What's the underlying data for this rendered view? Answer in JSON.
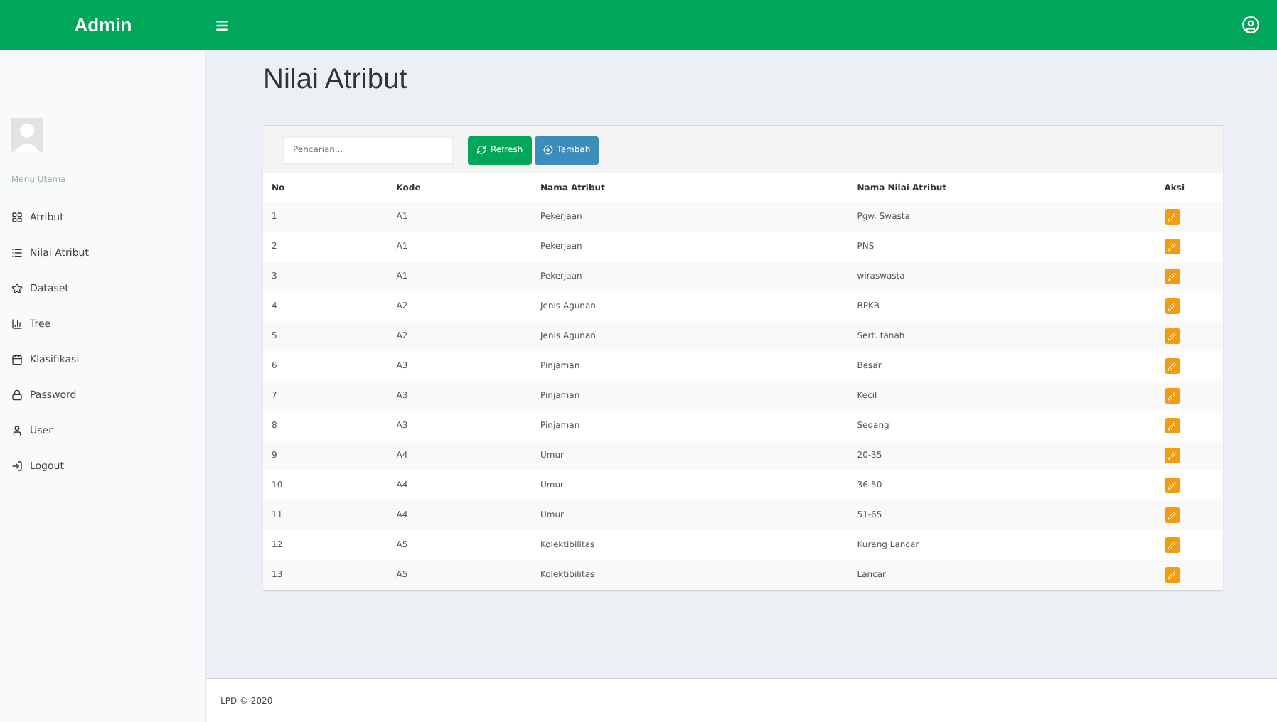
{
  "brand": "Admin",
  "sidebar": {
    "header": "Menu Utama",
    "items": [
      {
        "label": "Atribut"
      },
      {
        "label": "Nilai Atribut"
      },
      {
        "label": "Dataset"
      },
      {
        "label": "Tree"
      },
      {
        "label": "Klasifikasi"
      },
      {
        "label": "Password"
      },
      {
        "label": "User"
      },
      {
        "label": "Logout"
      }
    ]
  },
  "page_title": "Nilai Atribut",
  "search": {
    "placeholder": "Pencarian..."
  },
  "buttons": [
    {
      "label": "Refresh",
      "kind": "refresh"
    },
    {
      "label": "Tambah",
      "kind": "add"
    }
  ],
  "table": {
    "columns": [
      "No",
      "Kode",
      "Nama Atribut",
      "Nama Nilai Atribut",
      "Aksi"
    ],
    "rows": [
      [
        "1",
        "A1",
        "Pekerjaan",
        "Pgw. Swasta"
      ],
      [
        "2",
        "A1",
        "Pekerjaan",
        "PNS"
      ],
      [
        "3",
        "A1",
        "Pekerjaan",
        "wiraswasta"
      ],
      [
        "4",
        "A2",
        "Jenis Agunan",
        "BPKB"
      ],
      [
        "5",
        "A2",
        "Jenis Agunan",
        "Sert. tanah"
      ],
      [
        "6",
        "A3",
        "Pinjaman",
        "Besar"
      ],
      [
        "7",
        "A3",
        "Pinjaman",
        "Kecil"
      ],
      [
        "8",
        "A3",
        "Pinjaman",
        "Sedang"
      ],
      [
        "9",
        "A4",
        "Umur",
        "20-35"
      ],
      [
        "10",
        "A4",
        "Umur",
        "36-50"
      ],
      [
        "11",
        "A4",
        "Umur",
        "51-65"
      ],
      [
        "12",
        "A5",
        "Kolektibilitas",
        "Kurang Lancar"
      ],
      [
        "13",
        "A5",
        "Kolektibilitas",
        "Lancar"
      ]
    ]
  },
  "footer": "LPD © 2020"
}
